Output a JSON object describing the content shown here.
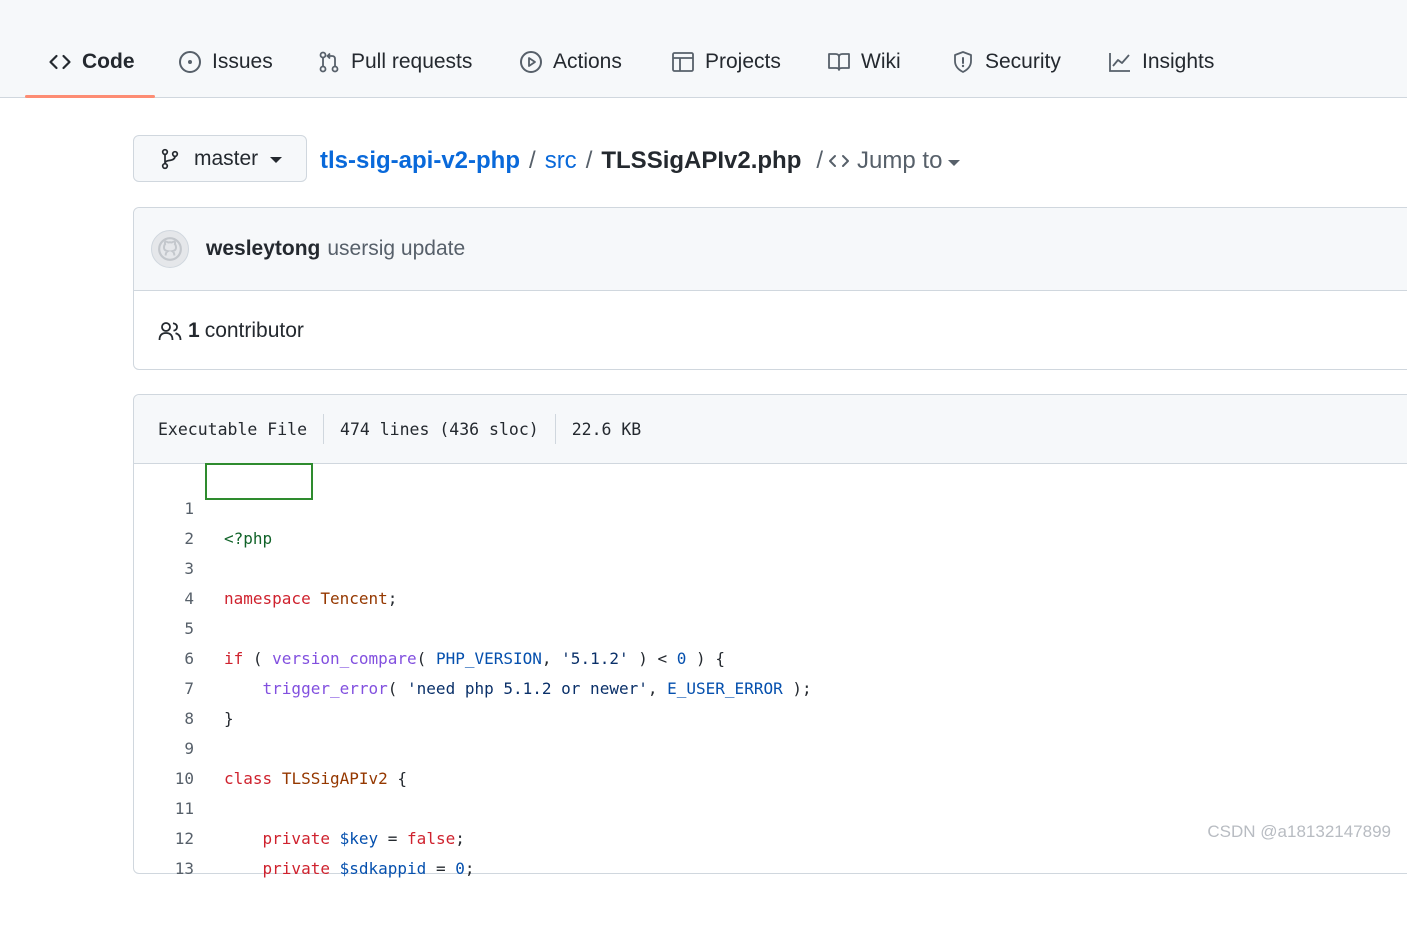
{
  "nav": {
    "tabs": [
      {
        "label": "Code",
        "icon": "code-icon",
        "selected": true
      },
      {
        "label": "Issues",
        "icon": "issue-opened-icon"
      },
      {
        "label": "Pull requests",
        "icon": "git-pull-request-icon"
      },
      {
        "label": "Actions",
        "icon": "play-icon"
      },
      {
        "label": "Projects",
        "icon": "table-icon"
      },
      {
        "label": "Wiki",
        "icon": "book-icon"
      },
      {
        "label": "Security",
        "icon": "shield-icon"
      },
      {
        "label": "Insights",
        "icon": "graph-icon"
      }
    ],
    "selected_underline_color": "#fd8c73"
  },
  "breadcrumb": {
    "branch": "master",
    "repo": "tls-sig-api-v2-php",
    "folder": "src",
    "file": "TLSSigAPIv2.php",
    "jump_to": "Jump to",
    "separator": "/"
  },
  "commit": {
    "author": "wesleytong",
    "message": "usersig update",
    "contributors_count": "1",
    "contributors_label": "contributor"
  },
  "file": {
    "mode": "Executable File",
    "lines": "474 lines (436 sloc)",
    "size": "22.6 KB"
  },
  "code": {
    "line_numbers": [
      "1",
      "2",
      "3",
      "4",
      "5",
      "6",
      "7",
      "8",
      "9",
      "10",
      "11",
      "12",
      "13"
    ],
    "lines": [
      "<?php",
      "",
      "namespace Tencent;",
      "",
      "if ( version_compare( PHP_VERSION, '5.1.2' ) < 0 ) {",
      "    trigger_error( 'need php 5.1.2 or newer', E_USER_ERROR );",
      "}",
      "",
      "class TLSSigAPIv2 {",
      "",
      "    private $key = false;",
      "    private $sdkappid = 0;",
      ""
    ]
  },
  "watermark": "CSDN @a18132147899",
  "colors": {
    "link": "#0969da",
    "keyword": "#cf222e",
    "function": "#8250df",
    "constant": "#0550ae",
    "highlight_box": "#2e8b2e"
  }
}
